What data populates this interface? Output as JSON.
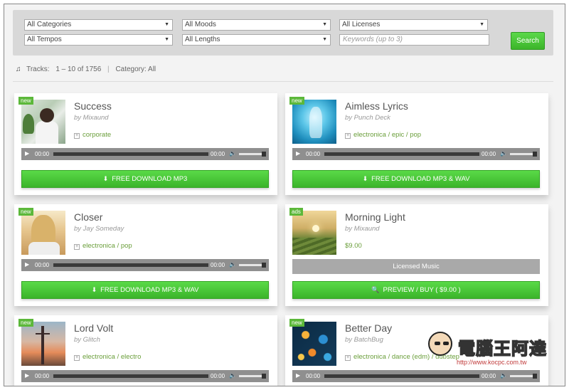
{
  "filters": {
    "categories": "All Categories",
    "moods": "All Moods",
    "licenses": "All Licenses",
    "tempos": "All Tempos",
    "lengths": "All Lengths",
    "keywords_placeholder": "Keywords (up to 3)",
    "search_label": "Search"
  },
  "tracks_info": {
    "label": "Tracks:",
    "range": "1 – 10 of 1756",
    "separator": "|",
    "category": "Category: All"
  },
  "tracks": [
    {
      "badge": "new",
      "title": "Success",
      "artist": "by Mixaund",
      "tags": "corporate",
      "time_start": "00:00",
      "time_end": "00:00",
      "button": "FREE DOWNLOAD  MP3"
    },
    {
      "badge": "new",
      "title": "Aimless Lyrics",
      "artist": "by Punch Deck",
      "tags": "electronica / epic / pop",
      "time_start": "00:00",
      "time_end": "00:00",
      "button": "FREE DOWNLOAD  MP3 & WAV"
    },
    {
      "badge": "new",
      "title": "Closer",
      "artist": "by Jay Someday",
      "tags": "electronica / pop",
      "time_start": "00:00",
      "time_end": "00:00",
      "button": "FREE DOWNLOAD  MP3 & WAV"
    },
    {
      "badge": "ads",
      "title": "Morning Light",
      "artist": "by Mixaund",
      "price": "$9.00",
      "licensed": "Licensed Music",
      "button": "PREVIEW / BUY ( $9.00 )"
    },
    {
      "badge": "new",
      "title": "Lord Volt",
      "artist": "by Glitch",
      "tags": "electronica / electro",
      "time_start": "00:00",
      "time_end": "00:00"
    },
    {
      "badge": "new",
      "title": "Better Day",
      "artist": "by BatchBug",
      "tags": "electronica / dance (edm) / dubstep",
      "time_start": "00:00",
      "time_end": "00:00"
    }
  ],
  "watermark": {
    "text": "電腦王阿達",
    "url": "http://www.kocpc.com.tw"
  },
  "colors": {
    "accent_green": "#46c635",
    "tag_green": "#6a9e3a",
    "badge_green": "#5cb83a",
    "player_gray": "#8f8f8f"
  }
}
